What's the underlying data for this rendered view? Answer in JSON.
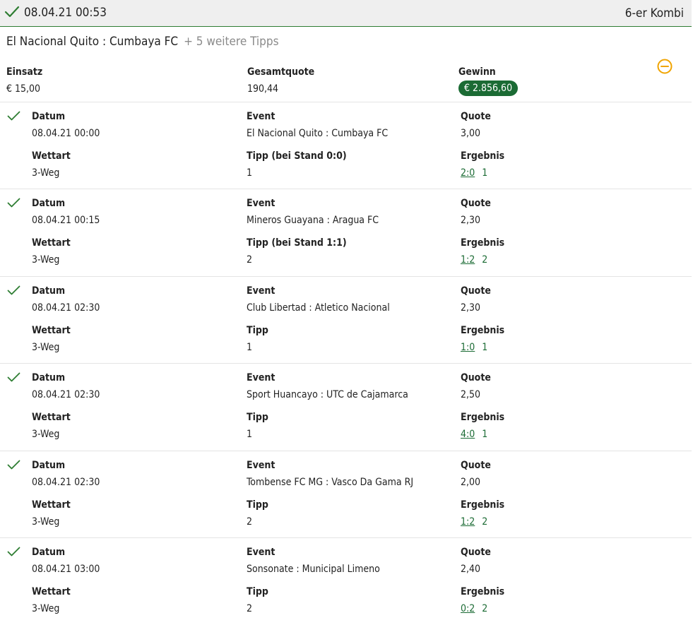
{
  "header": {
    "datetime": "08.04.21 00:53",
    "kombi": "6-er Kombi"
  },
  "match_line": {
    "title": "El Nacional Quito : Cumbaya FC",
    "more": "+ 5 weitere Tipps"
  },
  "summary": {
    "einsatz_label": "Einsatz",
    "einsatz_value": "€ 15,00",
    "gesamtquote_label": "Gesamtquote",
    "gesamtquote_value": "190,44",
    "gewinn_label": "Gewinn",
    "gewinn_value": "€ 2.856,60"
  },
  "labels": {
    "datum": "Datum",
    "event": "Event",
    "quote": "Quote",
    "wettart": "Wettart",
    "ergebnis": "Ergebnis"
  },
  "legs": [
    {
      "datum": "08.04.21 00:00",
      "event": "El Nacional Quito : Cumbaya FC",
      "quote": "3,00",
      "wettart": "3-Weg",
      "tipp_label": "Tipp (bei Stand 0:0)",
      "tipp": "1",
      "score": "2:0",
      "outcome": "1"
    },
    {
      "datum": "08.04.21 00:15",
      "event": "Mineros Guayana : Aragua FC",
      "quote": "2,30",
      "wettart": "3-Weg",
      "tipp_label": "Tipp (bei Stand 1:1)",
      "tipp": "2",
      "score": "1:2",
      "outcome": "2"
    },
    {
      "datum": "08.04.21 02:30",
      "event": "Club Libertad : Atletico Nacional",
      "quote": "2,30",
      "wettart": "3-Weg",
      "tipp_label": "Tipp",
      "tipp": "1",
      "score": "1:0",
      "outcome": "1"
    },
    {
      "datum": "08.04.21 02:30",
      "event": "Sport Huancayo : UTC de Cajamarca",
      "quote": "2,50",
      "wettart": "3-Weg",
      "tipp_label": "Tipp",
      "tipp": "1",
      "score": "4:0",
      "outcome": "1"
    },
    {
      "datum": "08.04.21 02:30",
      "event": "Tombense FC MG : Vasco Da Gama RJ",
      "quote": "2,00",
      "wettart": "3-Weg",
      "tipp_label": "Tipp",
      "tipp": "2",
      "score": "1:2",
      "outcome": "2"
    },
    {
      "datum": "08.04.21 03:00",
      "event": "Sonsonate : Municipal Limeno",
      "quote": "2,40",
      "wettart": "3-Weg",
      "tipp_label": "Tipp",
      "tipp": "2",
      "score": "0:2",
      "outcome": "2"
    }
  ],
  "colors": {
    "accent_green": "#1b6b34",
    "check_green": "#2e7d32",
    "collapse_orange": "#f0a400",
    "header_bg": "#efefef"
  },
  "icons": {
    "status": "checkmark-icon",
    "collapse": "minus-circle-icon"
  }
}
